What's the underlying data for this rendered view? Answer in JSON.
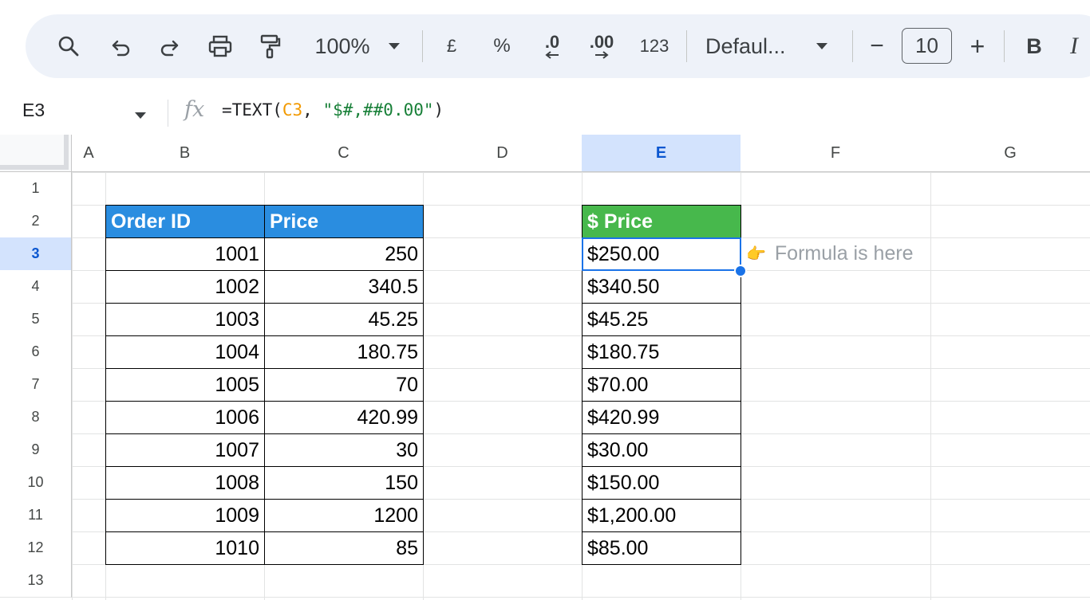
{
  "toolbar": {
    "zoom": "100%",
    "currency_symbol": "£",
    "percent_symbol": "%",
    "decrease_decimal": ".0",
    "increase_decimal": ".00",
    "number_format": "123",
    "font_name": "Defaul...",
    "font_size": "10",
    "minus": "−",
    "plus": "+",
    "bold": "B",
    "italic": "I"
  },
  "formula_bar": {
    "cell_ref": "E3",
    "fx": "fx",
    "prefix": "=TEXT(",
    "ref": "C3",
    "sep": ", ",
    "string": "\"$#,##0.00\"",
    "suffix": ")"
  },
  "columns": [
    "A",
    "B",
    "C",
    "D",
    "E",
    "F",
    "G"
  ],
  "selected_column": "E",
  "rows": [
    "1",
    "2",
    "3",
    "4",
    "5",
    "6",
    "7",
    "8",
    "9",
    "10",
    "11",
    "12",
    "13"
  ],
  "selected_row": "3",
  "table": {
    "headers": [
      "Order ID",
      "Price"
    ],
    "order_ids": [
      "1001",
      "1002",
      "1003",
      "1004",
      "1005",
      "1006",
      "1007",
      "1008",
      "1009",
      "1010"
    ],
    "prices": [
      "250",
      "340.5",
      "45.25",
      "180.75",
      "70",
      "420.99",
      "30",
      "150",
      "1200",
      "85"
    ]
  },
  "formatted": {
    "header": "$ Price",
    "values": [
      "$250.00",
      "$340.50",
      "$45.25",
      "$180.75",
      "$70.00",
      "$420.99",
      "$30.00",
      "$150.00",
      "$1,200.00",
      "$85.00"
    ]
  },
  "annotation": {
    "icon": "👈",
    "text": "Formula is here"
  },
  "colors": {
    "header_blue": "#2a8de0",
    "header_green": "#47b84c",
    "selection": "#1a73e8"
  }
}
